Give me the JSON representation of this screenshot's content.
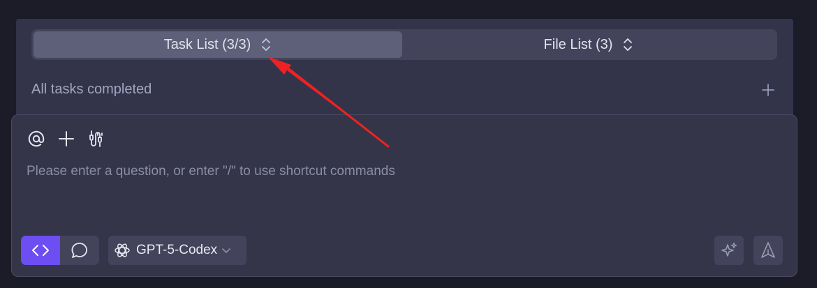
{
  "tabs": [
    {
      "label": "Task List (3/3)",
      "icon": "expand-collapse-icon",
      "active": true
    },
    {
      "label": "File List (3)",
      "icon": "expand-collapse-icon",
      "active": false
    }
  ],
  "tasks": {
    "status_text": "All tasks completed",
    "add_icon": "plus-icon"
  },
  "composer": {
    "tools": [
      "at-mention-icon",
      "plus-icon",
      "plug-icon"
    ],
    "placeholder": "Please enter a question, or enter \"/\" to use shortcut commands",
    "value": "",
    "modes": [
      {
        "icon": "code-icon",
        "active": true
      },
      {
        "icon": "chat-bubble-icon",
        "active": false
      }
    ],
    "model": {
      "name": "GPT-5-Codex",
      "icon": "openai-logo-icon"
    },
    "actions": [
      "sparkle-icon",
      "send-icon"
    ]
  },
  "colors": {
    "background": "#1c1c28",
    "panel": "#33344a",
    "active_tab": "#5e6079",
    "accent": "#6c4ef2",
    "annotation_arrow": "#ee2222"
  },
  "annotation": {
    "type": "arrow",
    "points_to": "tab-task-list-toggle-icon"
  }
}
